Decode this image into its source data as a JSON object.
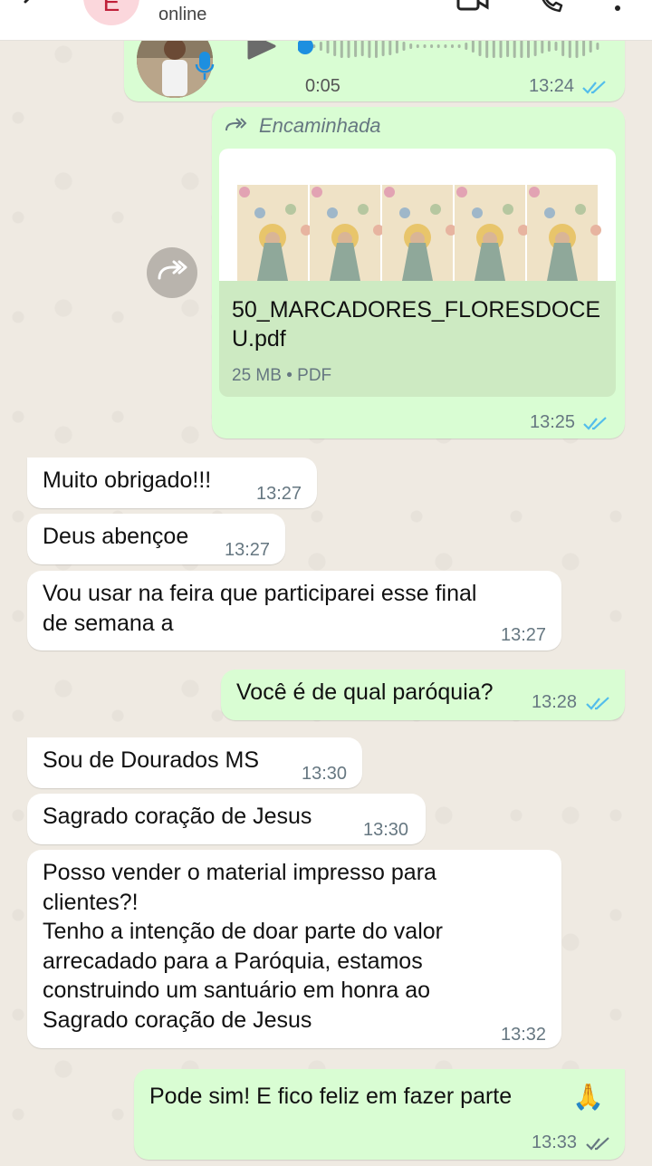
{
  "header": {
    "avatar_letter": "E",
    "status": "online",
    "back_icon": "back-arrow-icon",
    "video_icon": "video-call-icon",
    "call_icon": "phone-call-icon",
    "menu_icon": "menu-dots-icon"
  },
  "voice_message": {
    "duration": "0:05",
    "time": "13:24",
    "progress": 0.0
  },
  "forwarded_document": {
    "forwarded_label": "Encaminhada",
    "file_name": "50_MARCADORES_FLORESDOCEU.pdf",
    "size": "25 MB",
    "type": "PDF",
    "time": "13:25"
  },
  "messages": [
    {
      "text": "Muito obrigado!!!",
      "time": "13:27",
      "direction": "in"
    },
    {
      "text": "Deus abençoe",
      "time": "13:27",
      "direction": "in"
    },
    {
      "text": "Vou usar na feira que participarei esse final\nde semana a",
      "time": "13:27",
      "direction": "in"
    },
    {
      "text": "Você é de qual paróquia?",
      "time": "13:28",
      "direction": "out"
    },
    {
      "text": "Sou de Dourados MS",
      "time": "13:30",
      "direction": "in"
    },
    {
      "text": "Sagrado coração de Jesus",
      "time": "13:30",
      "direction": "in"
    },
    {
      "text": "Posso vender o material impresso para\nclientes?!\nTenho a intenção de doar parte do valor\narrecadado para a Paróquia, estamos\nconstruindo um santuário em honra ao\nSagrado coração de Jesus",
      "time": "13:32",
      "direction": "in"
    },
    {
      "text": "Pode sim! E fico feliz em fazer parte",
      "time": "13:33",
      "direction": "out",
      "emoji": "🙏"
    }
  ],
  "colors": {
    "outgoing_bubble": "#d9fdd3",
    "incoming_bubble": "#ffffff",
    "read_ticks": "#53bdeb",
    "delivered_ticks": "#667781",
    "chat_background": "#efeae2"
  }
}
